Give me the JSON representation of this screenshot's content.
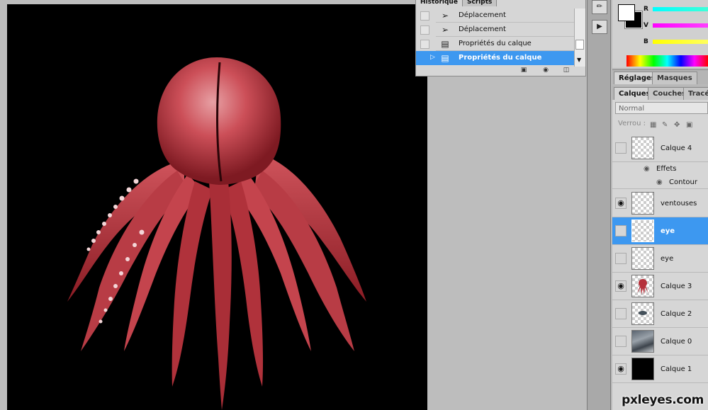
{
  "history": {
    "tabs": [
      "Historique",
      "Scripts"
    ],
    "items": [
      {
        "label": "Déplacement",
        "icon": "move-tool-icon",
        "selected": false
      },
      {
        "label": "Déplacement",
        "icon": "move-tool-icon",
        "selected": false
      },
      {
        "label": "Propriétés du calque",
        "icon": "layer-properties-icon",
        "selected": false
      },
      {
        "label": "Propriétés du calque",
        "icon": "layer-properties-icon",
        "selected": true
      }
    ]
  },
  "color": {
    "channels": [
      "R",
      "V",
      "B"
    ],
    "fg": "#ffffff",
    "bg": "#000000"
  },
  "adjust_tabs": [
    "Réglages",
    "Masques"
  ],
  "layer_tabs": [
    "Calques",
    "Couches",
    "Tracés"
  ],
  "layers": {
    "blend_mode": "Normal",
    "lock_label": "Verrou :",
    "effects_label": "Effets",
    "effect_name": "Contour",
    "items": [
      {
        "name": "Calque 4",
        "visible": false,
        "selected": false,
        "thumb": "transparent"
      },
      {
        "name": "ventouses",
        "visible": true,
        "selected": false,
        "thumb": "transparent"
      },
      {
        "name": "eye",
        "visible": false,
        "selected": true,
        "thumb": "transparent"
      },
      {
        "name": "eye",
        "visible": false,
        "selected": false,
        "thumb": "transparent"
      },
      {
        "name": "Calque 3",
        "visible": true,
        "selected": false,
        "thumb": "octopus"
      },
      {
        "name": "Calque 2",
        "visible": false,
        "selected": false,
        "thumb": "small-object"
      },
      {
        "name": "Calque 0",
        "visible": false,
        "selected": false,
        "thumb": "photo"
      },
      {
        "name": "Calque 1",
        "visible": true,
        "selected": false,
        "thumb": "black"
      }
    ]
  },
  "watermark": "pxleyes.com",
  "colors": {
    "selection": "#3d98f0",
    "octopus": "#c8404a",
    "canvas": "#000000"
  }
}
